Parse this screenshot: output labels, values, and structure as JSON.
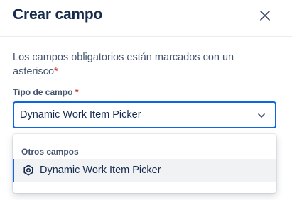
{
  "dialog": {
    "title": "Crear campo",
    "description": "Los campos obligatorios están marcados con un asterisco",
    "required_mark": "*"
  },
  "field": {
    "label": "Tipo de campo",
    "required_mark": "*",
    "value": "Dynamic Work Item Picker"
  },
  "menu": {
    "group_label": "Otros campos",
    "options": [
      {
        "label": "Dynamic Work Item Picker",
        "icon": "hexagon-settings-icon",
        "selected": true
      }
    ]
  },
  "colors": {
    "focus": "#0c66e4",
    "required": "#c9372c",
    "text": "#172b4d",
    "subtle_text": "#44546f",
    "option_selected_bg": "#f1f2f4"
  }
}
